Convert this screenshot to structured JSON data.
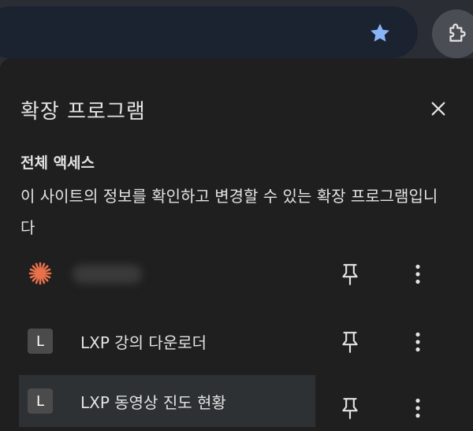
{
  "browser": {
    "star_icon": "star-icon",
    "star_color": "#8ab4f8",
    "extensions_icon": "puzzle-icon"
  },
  "panel": {
    "title": "확장 프로그램",
    "close_icon": "close-icon",
    "section": {
      "heading": "전체 액세스",
      "description": "이 사이트의 정보를 확인하고 변경할 수 있는 확장 프로그램입니다"
    },
    "extensions": [
      {
        "name": "",
        "icon": "starburst-icon",
        "icon_color": "#e8704a",
        "name_blurred": true
      },
      {
        "name": "LXP 강의 다운로더",
        "icon_letter": "L"
      },
      {
        "name": "LXP 동영상 진도 현황",
        "icon_letter": "L",
        "highlighted": true
      }
    ]
  }
}
